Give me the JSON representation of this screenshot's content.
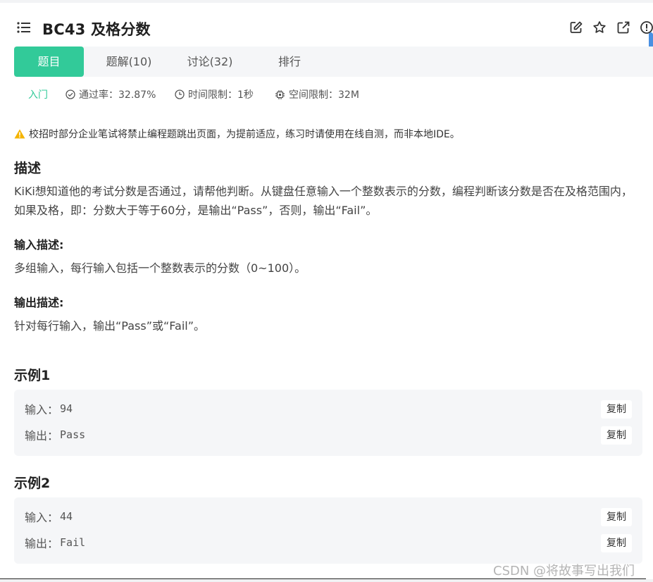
{
  "header": {
    "title": "BC43  及格分数",
    "icons": [
      "edit-icon",
      "star-icon",
      "external-link-icon",
      "alert-circle-icon"
    ]
  },
  "tabs": [
    {
      "label": "题目",
      "active": true
    },
    {
      "label": "题解(10)",
      "active": false
    },
    {
      "label": "讨论(32)",
      "active": false
    },
    {
      "label": "排行",
      "active": false
    }
  ],
  "meta": {
    "level": "入门",
    "pass_rate": "通过率：32.87%",
    "time_limit": "时间限制：1秒",
    "space_limit": "空间限制：32M"
  },
  "warning": "校招时部分企业笔试将禁止编程题跳出页面，为提前适应，练习时请使用在线自测，而非本地IDE。",
  "description": {
    "heading": "描述",
    "text": "KiKi想知道他的考试分数是否通过，请帮他判断。从键盘任意输入一个整数表示的分数，编程判断该分数是否在及格范围内，如果及格，即：分数大于等于60分，是输出“Pass”，否则，输出“Fail”。"
  },
  "input_desc": {
    "heading": "输入描述:",
    "text": "多组输入，每行输入包括一个整数表示的分数（0~100）。"
  },
  "output_desc": {
    "heading": "输出描述:",
    "text": "针对每行输入，输出“Pass”或“Fail”。"
  },
  "examples": [
    {
      "title": "示例1",
      "input_label": "输入：",
      "input": "94",
      "output_label": "输出：",
      "output": "Pass",
      "copy": "复制"
    },
    {
      "title": "示例2",
      "input_label": "输入：",
      "input": "44",
      "output_label": "输出：",
      "output": "Fail",
      "copy": "复制"
    }
  ],
  "watermark": "CSDN @将故事写出我们",
  "colors": {
    "accent": "#32ca99",
    "warning": "#f5b400",
    "scrollbar": "#4a90e2"
  }
}
